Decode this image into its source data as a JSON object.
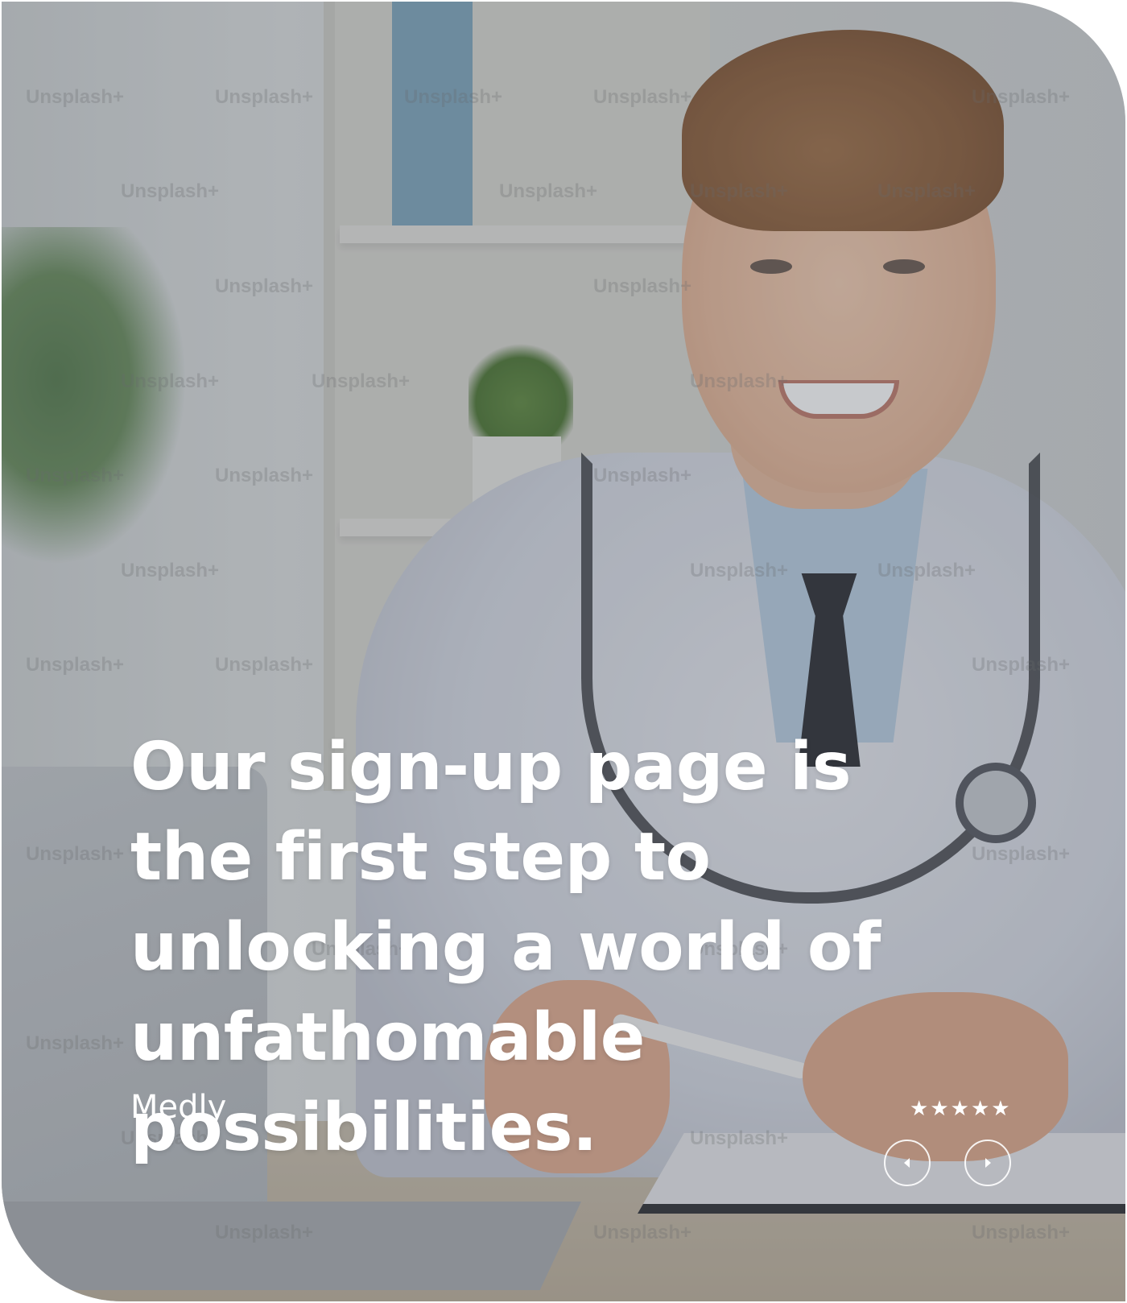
{
  "testimonial": {
    "quote": "Our sign-up page is the first step to unlocking a world of unfathomable possibilities.",
    "author": "Medly",
    "rating": 5,
    "stars": [
      "★",
      "★",
      "★",
      "★",
      "★"
    ]
  },
  "carousel": {
    "prev_icon": "chevron-left-icon",
    "next_icon": "chevron-right-icon"
  },
  "watermark": {
    "text": "Unsplash+"
  },
  "colors": {
    "text": "#ffffff",
    "overlay": "rgba(70,75,85,0.30)"
  }
}
